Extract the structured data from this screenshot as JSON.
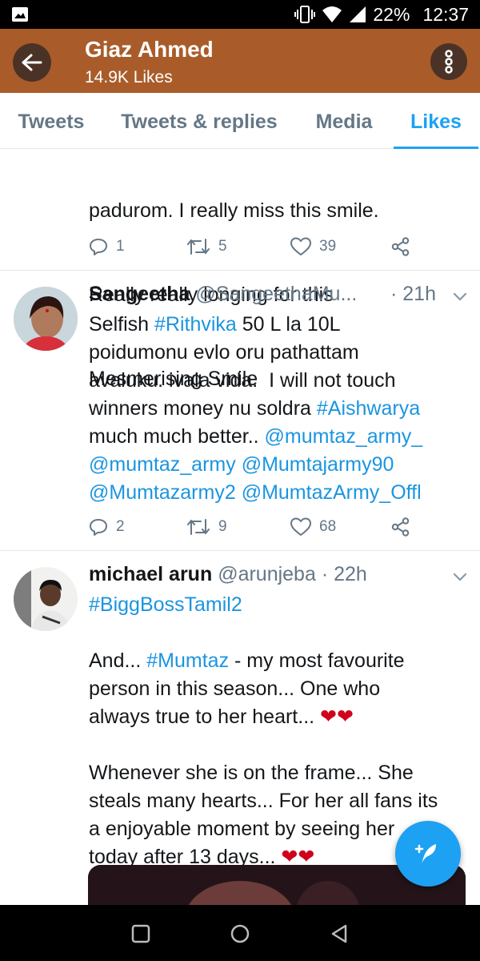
{
  "status_bar": {
    "battery": "22%",
    "time": "12:37",
    "icons": [
      "image-icon",
      "vibrate-icon",
      "wifi-icon",
      "signal-icon",
      "battery-icon"
    ]
  },
  "header": {
    "title": "Giaz Ahmed",
    "subtitle": "14.9K Likes",
    "background": "#a95c2a"
  },
  "tabs": [
    {
      "label": "Tweets"
    },
    {
      "label": "Tweets & replies"
    },
    {
      "label": "Media"
    },
    {
      "label": "Likes",
      "active": true
    }
  ],
  "tweets": [
    {
      "text_lines": [
        "padurom. I really miss this smile.",
        "Really really longing for this",
        "Mesmerising Smile"
      ],
      "replies": "1",
      "retweets": "5",
      "likes": "39"
    },
    {
      "name": "Sangeetha",
      "handle": "@SangeethaMu...",
      "time": "· 21h",
      "text_segments": [
        {
          "t": "Selfish "
        },
        {
          "t": "#Rithvika",
          "link": true
        },
        {
          "t": " 50 L la 10L\npoidumonu evlo oru pathattam\navaluku. ivala vida.  I will not touch\nwinners money nu soldra "
        },
        {
          "t": "#Aishwarya",
          "link": true
        },
        {
          "t": "\nmuch much better.. "
        },
        {
          "t": "@mumtaz_army_",
          "link": true
        },
        {
          "t": "\n"
        },
        {
          "t": "@mumtaz_army",
          "link": true
        },
        {
          "t": " "
        },
        {
          "t": "@Mumtajarmy90",
          "link": true
        },
        {
          "t": "\n"
        },
        {
          "t": "@Mumtazarmy2",
          "link": true
        },
        {
          "t": " "
        },
        {
          "t": "@MumtazArmy_Offl",
          "link": true
        }
      ],
      "replies": "2",
      "retweets": "9",
      "likes": "68"
    },
    {
      "name": "michael arun",
      "handle": "@arunjeba",
      "time": "· 22h",
      "text_segments": [
        {
          "t": "#BiggBossTamil2",
          "link": true
        },
        {
          "t": "\n\nAnd... "
        },
        {
          "t": "#Mumtaz",
          "link": true
        },
        {
          "t": " - my most favourite\nperson in this season... One who\nalways true to her heart... ❤❤\n\nWhenever she is on the frame... She\nsteals many hearts... For her all fans its\na enjoyable moment by seeing her\ntoday after 13 days... ❤❤"
        }
      ]
    }
  ],
  "colors": {
    "accent": "#1da1f2",
    "link": "#1b95e0",
    "muted": "#657786",
    "heart": "#d0021b"
  }
}
